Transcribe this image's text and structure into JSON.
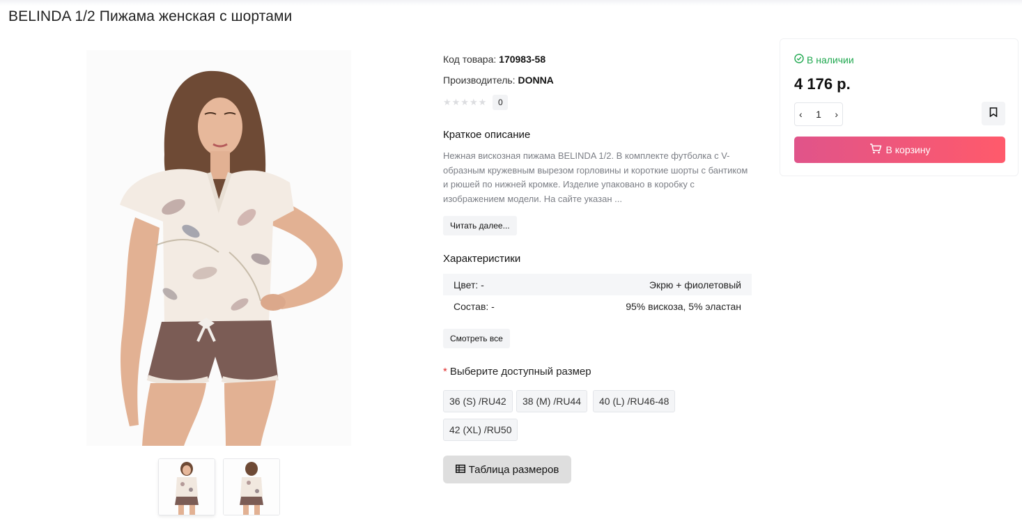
{
  "product": {
    "title": "BELINDA 1/2 Пижама женская с шортами",
    "code_label": "Код товара:",
    "code_value": "170983-58",
    "maker_label": "Производитель:",
    "maker_value": "DONNA",
    "rating_stars": "★★★★★",
    "rating_count": "0"
  },
  "description": {
    "title": "Краткое описание",
    "text": "Нежная вискозная пижама BELINDA 1/2. В комплекте футболка с V-образным кружевным вырезом горловины и короткие шорты с бантиком и рюшей по нижней кромке. Изделие упаковано в коробку с изображением модели. На сайте указан ...",
    "read_more": "Читать далее..."
  },
  "specs": {
    "title": "Характеристики",
    "rows": [
      {
        "name": "Цвет: -",
        "value": "Экрю + фиолетовый"
      },
      {
        "name": "Состав: -",
        "value": "95% вискоза, 5% эластан"
      }
    ],
    "see_all": "Смотреть все"
  },
  "sizes": {
    "required_mark": "*",
    "label": "Выберите доступный размер",
    "options": [
      "36 (S) /RU42",
      "38 (M) /RU44",
      "40 (L) /RU46-48",
      "42 (XL) /RU50"
    ],
    "size_table_label": "Таблица размеров"
  },
  "buy": {
    "stock": "В наличии",
    "price": "4 176 р.",
    "qty": "1",
    "qty_minus": "‹",
    "qty_plus": "›",
    "cart_label": "В корзину"
  },
  "colors": {
    "accent_start": "#e0548a",
    "accent_end": "#ff5a6b",
    "stock_green": "#1fa84f",
    "required_red": "#e02d2d"
  },
  "icons": [
    "check-circle-icon",
    "bookmark-icon",
    "cart-icon",
    "table-icon",
    "chevron-left-icon",
    "chevron-right-icon"
  ]
}
